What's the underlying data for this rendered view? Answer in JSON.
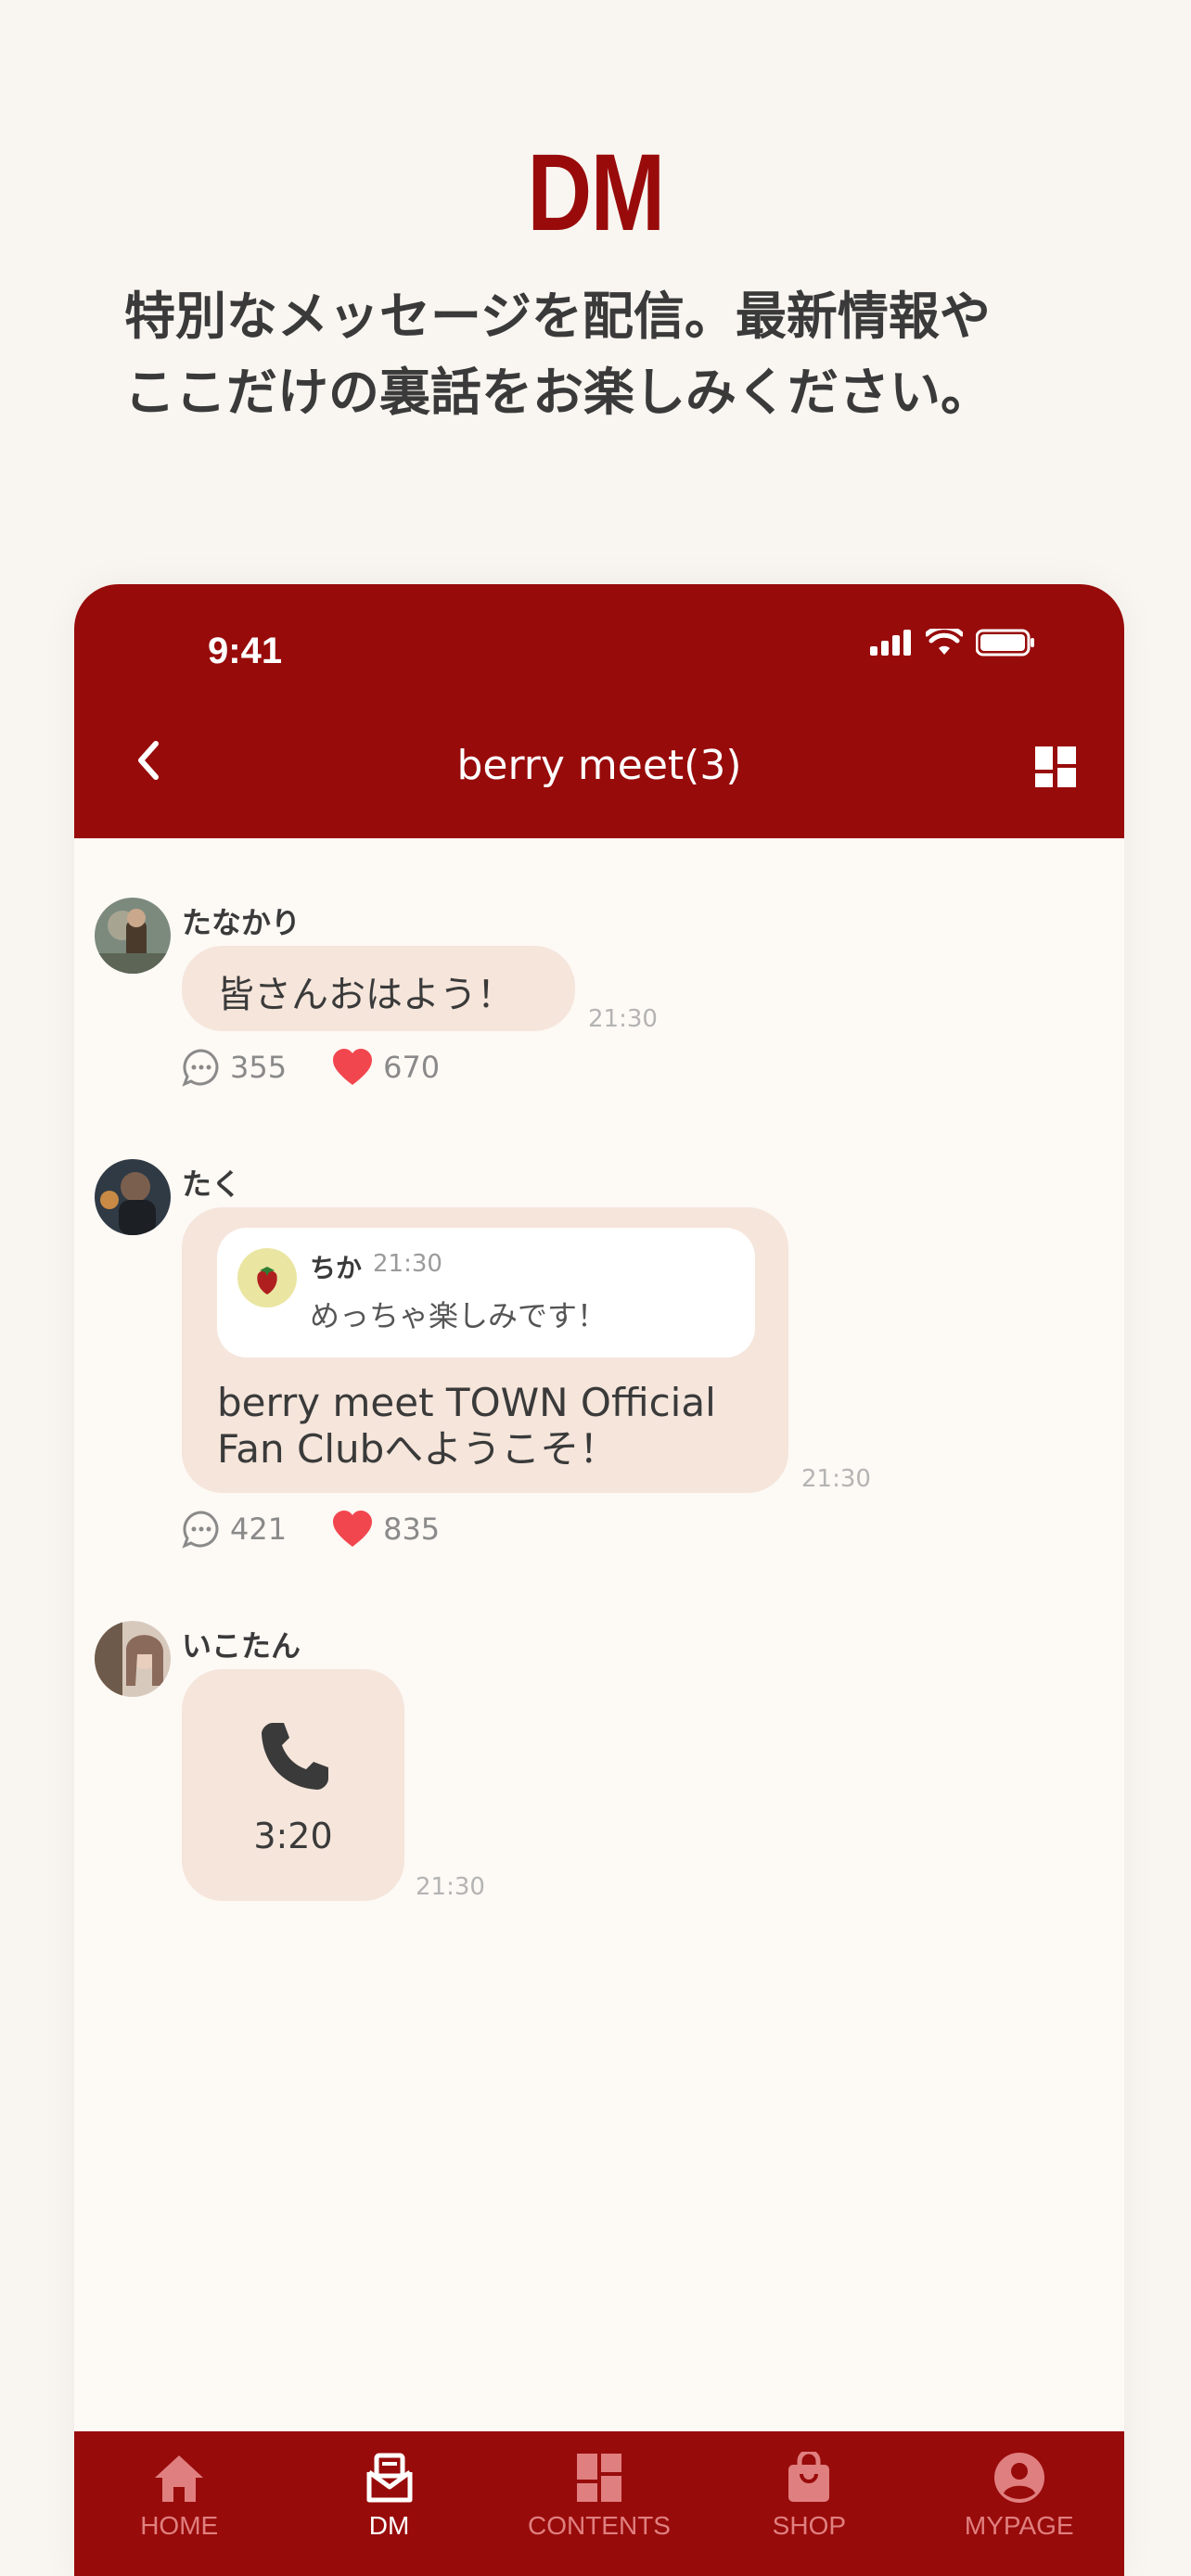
{
  "promo": {
    "headline": "DM",
    "line1": "特別なメッセージを配信。最新情報や",
    "line2": "ここだけの裏話をお楽しみください。"
  },
  "status": {
    "time": "9:41"
  },
  "nav": {
    "title": "berry meet(3)"
  },
  "messages": [
    {
      "sender": "たなかり",
      "text": "皆さんおはよう！",
      "time": "21:30",
      "comments": "355",
      "likes": "670"
    },
    {
      "sender": "たく",
      "quote": {
        "sender": "ちか",
        "time": "21:30",
        "text": "めっちゃ楽しみです！"
      },
      "text_line1": "berry meet TOWN Official",
      "text_line2": "Fan Clubへようこそ！",
      "time": "21:30",
      "comments": "421",
      "likes": "835"
    },
    {
      "sender": "いこたん",
      "call_duration": "3:20",
      "time": "21:30"
    }
  ],
  "tabs": [
    {
      "label": "HOME",
      "icon": "home-icon"
    },
    {
      "label": "DM",
      "icon": "dm-icon",
      "active": true
    },
    {
      "label": "CONTENTS",
      "icon": "contents-icon"
    },
    {
      "label": "SHOP",
      "icon": "shop-icon"
    },
    {
      "label": "MYPAGE",
      "icon": "mypage-icon"
    }
  ],
  "colors": {
    "brand": "#980b0b",
    "bubble": "#f5e5db",
    "heart": "#f2464e"
  }
}
